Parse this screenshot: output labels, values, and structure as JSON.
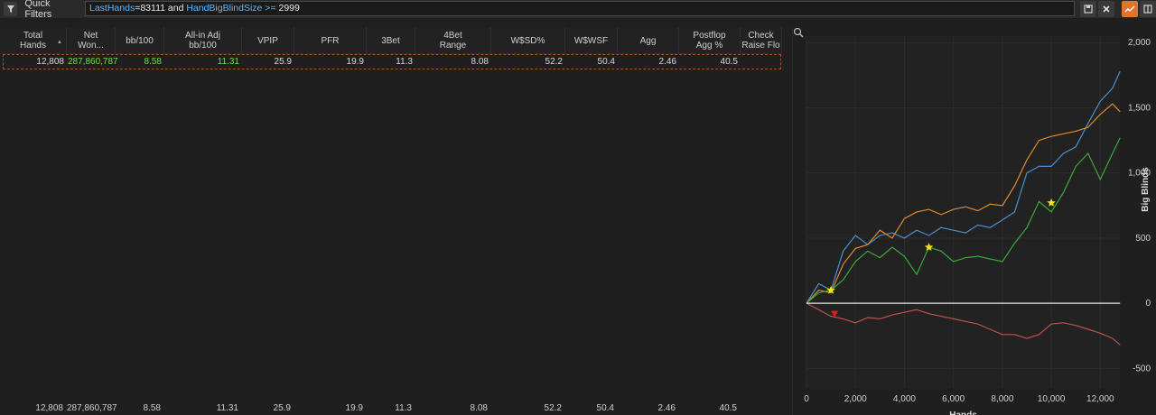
{
  "toolbar": {
    "quick_filters_label": "Quick Filters",
    "filter": {
      "p1": "LastHands",
      "p2": "=83111 and ",
      "p3": "HandBigBlindSize",
      "p4": " >= ",
      "p5": "2999"
    },
    "icons": [
      "filter-icon",
      "save-icon",
      "close-icon",
      "graph-icon",
      "layout-icon"
    ],
    "accent_color": "#e0742a"
  },
  "table": {
    "columns": [
      {
        "line1": "Total",
        "line2": "Hands"
      },
      {
        "line1": "Net",
        "line2": "Won..."
      },
      {
        "line1": "bb/100",
        "line2": ""
      },
      {
        "line1": "All-in Adj",
        "line2": "bb/100"
      },
      {
        "line1": "VPIP",
        "line2": ""
      },
      {
        "line1": "PFR",
        "line2": ""
      },
      {
        "line1": "3Bet",
        "line2": ""
      },
      {
        "line1": "4Bet",
        "line2": "Range"
      },
      {
        "line1": "W$SD%",
        "line2": ""
      },
      {
        "line1": "W$WSF",
        "line2": ""
      },
      {
        "line1": "Agg",
        "line2": ""
      },
      {
        "line1": "Postflop",
        "line2": "Agg %"
      },
      {
        "line1": "Check",
        "line2": "Raise Flo"
      }
    ],
    "row": [
      "12,808",
      "287,860,787",
      "8.58",
      "11.31",
      "25.9",
      "19.9",
      "11.3",
      "8.08",
      "52.2",
      "50.4",
      "2.46",
      "40.5",
      ""
    ],
    "footer": [
      "12,808",
      "287,860,787",
      "8.58",
      "11.31",
      "25.9",
      "19.9",
      "11.3",
      "8.08",
      "52.2",
      "50.4",
      "2.46",
      "40.5",
      ""
    ],
    "positive_color": "#6ddc4d"
  },
  "chart_data": {
    "type": "line",
    "xlabel": "Hands",
    "ylabel": "Big Blinds",
    "xlim": [
      0,
      12800
    ],
    "ylim": [
      -650,
      2050
    ],
    "x_ticks": [
      "0",
      "2,000",
      "4,000",
      "6,000",
      "8,000",
      "10,000",
      "12,000"
    ],
    "x_tick_values": [
      0,
      2000,
      4000,
      6000,
      8000,
      10000,
      12000
    ],
    "y_ticks": [
      "2,000",
      "1,500",
      "1,000",
      "500",
      "0",
      "-500"
    ],
    "y_tick_values": [
      2000,
      1500,
      1000,
      500,
      0,
      -500
    ],
    "series": [
      {
        "color": "#4a8fd0",
        "x": [
          0,
          500,
          1000,
          1500,
          2000,
          2500,
          3000,
          3500,
          4000,
          4500,
          5000,
          5500,
          6000,
          6500,
          7000,
          7500,
          8000,
          8500,
          9000,
          9500,
          10000,
          10500,
          11000,
          11500,
          12000,
          12500,
          12808
        ],
        "y": [
          0,
          150,
          100,
          400,
          520,
          450,
          520,
          540,
          500,
          560,
          520,
          580,
          560,
          540,
          600,
          580,
          640,
          700,
          1000,
          1050,
          1050,
          1150,
          1200,
          1380,
          1550,
          1650,
          1780
        ]
      },
      {
        "color": "#e08a30",
        "x": [
          0,
          500,
          1000,
          1500,
          2000,
          2500,
          3000,
          3500,
          4000,
          4500,
          5000,
          5500,
          6000,
          6500,
          7000,
          7500,
          8000,
          8500,
          9000,
          9500,
          10000,
          10500,
          11000,
          11500,
          12000,
          12500,
          12808
        ],
        "y": [
          0,
          100,
          80,
          300,
          420,
          450,
          560,
          500,
          650,
          700,
          720,
          680,
          720,
          740,
          710,
          760,
          750,
          900,
          1100,
          1250,
          1280,
          1300,
          1320,
          1350,
          1450,
          1530,
          1470
        ]
      },
      {
        "color": "#3aa83a",
        "x": [
          0,
          500,
          1000,
          1500,
          2000,
          2500,
          3000,
          3500,
          4000,
          4500,
          5000,
          5500,
          6000,
          6500,
          7000,
          7500,
          8000,
          8500,
          9000,
          9500,
          10000,
          10500,
          11000,
          11500,
          12000,
          12500,
          12808
        ],
        "y": [
          0,
          80,
          100,
          180,
          320,
          400,
          350,
          430,
          360,
          220,
          430,
          400,
          320,
          350,
          360,
          340,
          320,
          460,
          580,
          780,
          700,
          850,
          1050,
          1150,
          950,
          1150,
          1270
        ]
      },
      {
        "color": "#c0504d",
        "x": [
          0,
          500,
          1000,
          1500,
          2000,
          2500,
          3000,
          3500,
          4000,
          4500,
          5000,
          5500,
          6000,
          6500,
          7000,
          7500,
          8000,
          8500,
          9000,
          9500,
          10000,
          10500,
          11000,
          11500,
          12000,
          12500,
          12808
        ],
        "y": [
          0,
          -50,
          -100,
          -120,
          -150,
          -110,
          -120,
          -90,
          -70,
          -50,
          -80,
          -100,
          -120,
          -140,
          -160,
          -200,
          -240,
          -240,
          -270,
          -240,
          -160,
          -150,
          -170,
          -200,
          -230,
          -270,
          -320
        ]
      },
      {
        "color": "#e6e6e6",
        "x": [
          0,
          12808
        ],
        "y": [
          0,
          0
        ]
      }
    ],
    "markers": [
      {
        "type": "star",
        "color": "#f2e414",
        "x": 1000,
        "y": 100
      },
      {
        "type": "star",
        "color": "#f2e414",
        "x": 5000,
        "y": 430
      },
      {
        "type": "star",
        "color": "#f2e414",
        "x": 10000,
        "y": 770
      },
      {
        "type": "triangle-down",
        "color": "#e01d1d",
        "x": 1150,
        "y": -80
      }
    ],
    "grid": true
  }
}
